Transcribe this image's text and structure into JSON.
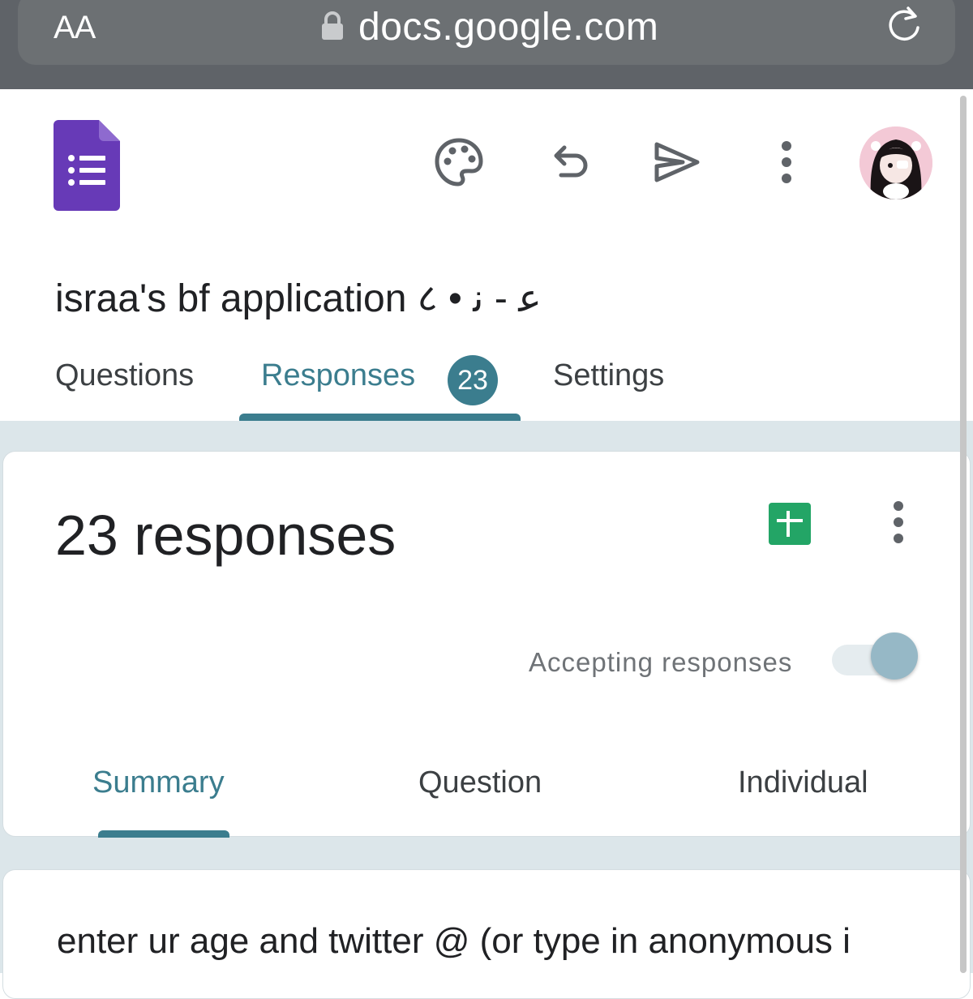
{
  "browser": {
    "text_size_label": "AA",
    "url": "docs.google.com",
    "icons": [
      "lock-icon",
      "reload-icon"
    ]
  },
  "header": {
    "app_icon": "google-forms-icon",
    "toolbar_icons": [
      "palette-icon",
      "undo-icon",
      "send-icon",
      "more-vert-icon"
    ],
    "avatar": "profile-avatar"
  },
  "form": {
    "title": "israa's bf application ८ • ﻋ - ﻧ"
  },
  "tabs": [
    {
      "label": "Questions",
      "active": false
    },
    {
      "label": "Responses",
      "active": true,
      "badge": "23"
    },
    {
      "label": "Settings",
      "active": false
    }
  ],
  "responses_card": {
    "count_label": "23 responses",
    "accepting_label": "Accepting responses",
    "accepting_on": true,
    "sub_tabs": [
      {
        "label": "Summary",
        "active": true
      },
      {
        "label": "Question",
        "active": false
      },
      {
        "label": "Individual",
        "active": false
      }
    ]
  },
  "question_card": {
    "text": "enter ur age and twitter @ (or type in anonymous i"
  },
  "colors": {
    "accent": "#3b7d8e",
    "forms_purple": "#673ab7",
    "sheets_green": "#23a566",
    "page_bg": "#dce6ea"
  }
}
